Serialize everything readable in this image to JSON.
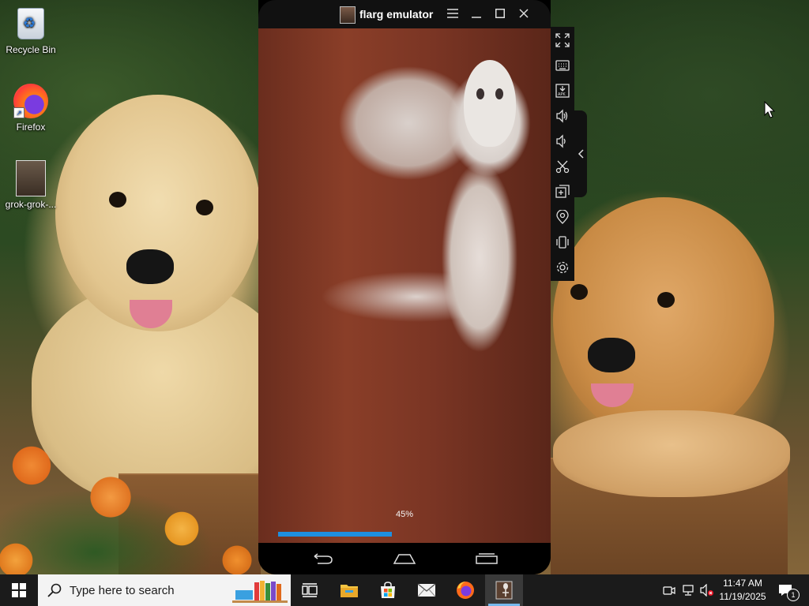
{
  "desktop": {
    "icons": [
      {
        "label": "Recycle Bin",
        "icon": "recycle-bin-icon"
      },
      {
        "label": "Firefox",
        "icon": "firefox-icon"
      },
      {
        "label": "grok-grok-...",
        "icon": "video-file-icon"
      }
    ]
  },
  "emulator": {
    "title": "flarg emulator",
    "titlebar_buttons": [
      "menu-icon",
      "minimize-icon",
      "maximize-icon",
      "close-icon"
    ],
    "progress": {
      "label": "45%",
      "value": 0.45,
      "color": "#1e8fe0"
    },
    "nav_buttons": [
      "back-icon",
      "home-icon",
      "recents-icon"
    ],
    "sidebar_buttons": [
      "fullscreen-icon",
      "keyboard-icon",
      "install-apk-icon",
      "volume-up-icon",
      "volume-down-icon",
      "screenshot-cut-icon",
      "multi-instance-icon",
      "location-icon",
      "shake-icon",
      "settings-icon"
    ],
    "sidebar_collapse": "chevron-left-icon"
  },
  "taskbar": {
    "search_placeholder": "Type here to search",
    "apps": [
      "task-view-icon",
      "file-explorer-icon",
      "microsoft-store-icon",
      "mail-icon",
      "firefox-icon",
      "flarg-emulator-icon"
    ],
    "active_app": "flarg-emulator-icon",
    "tray": [
      "meet-now-icon",
      "network-icon",
      "volume-muted-icon"
    ],
    "time": "11:47 AM",
    "date": "11/19/2025",
    "notification_count": "1"
  }
}
